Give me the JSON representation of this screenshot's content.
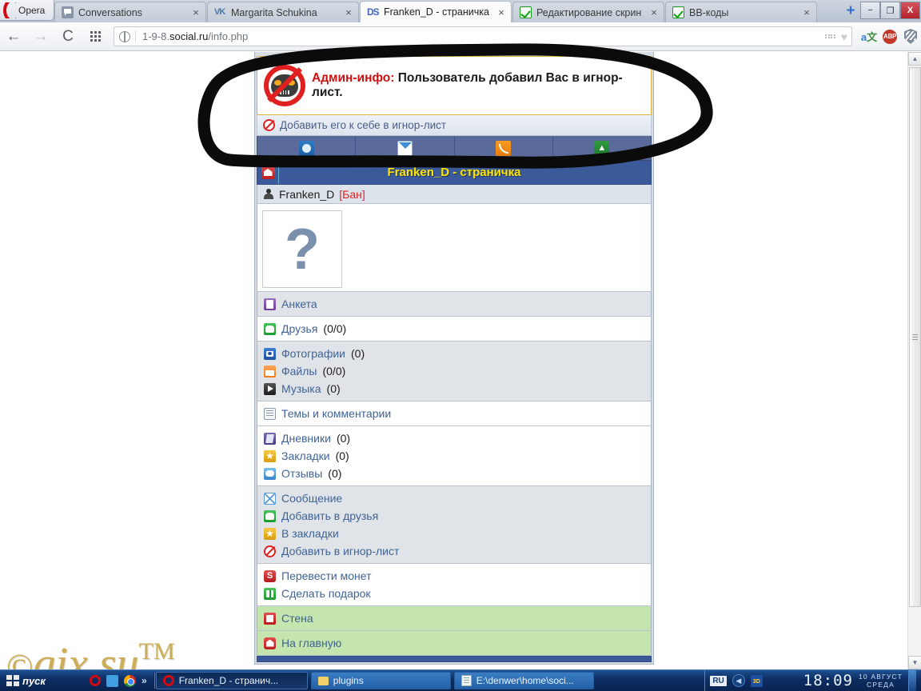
{
  "browser": {
    "app_button": "Opera",
    "tabs": [
      {
        "title": "Conversations",
        "favicon": "chat-icon",
        "active": false,
        "close": "×"
      },
      {
        "title": "Margarita Schukina",
        "favicon": "vk-icon",
        "active": false,
        "close": "×"
      },
      {
        "title": "Franken_D - страничка",
        "favicon": "ds-icon",
        "active": true,
        "close": "×"
      },
      {
        "title": "Редактирование скрин",
        "favicon": "checkbox-green-icon",
        "active": false,
        "close": "×"
      },
      {
        "title": "ВВ-коды",
        "favicon": "checkbox-green-icon",
        "active": false,
        "close": "×"
      }
    ],
    "new_tab": "+",
    "window_controls": {
      "minimize": "−",
      "maximize": "❐",
      "close": "X"
    },
    "url": {
      "prefix": "1-9-8.",
      "domain": "social.ru",
      "path": "/info.php"
    },
    "toolbar_icons": {
      "back": "←",
      "forward": "→",
      "reload": "C",
      "speeddial": "grid-icon",
      "translate": "translate-icon",
      "adblock": "ABP",
      "shield": "shield-icon"
    }
  },
  "page": {
    "notice": {
      "icon": "ban-robot-icon",
      "prefix": "Админ-инфо:",
      "message": "Пользователь добавил Вас в игнор-лист."
    },
    "ignore_bar": {
      "icon": "ban-icon",
      "label": "Добавить его к себе в игнор-лист"
    },
    "icon_row": [
      {
        "icon": "profile-blue-icon"
      },
      {
        "icon": "envelope-icon"
      },
      {
        "icon": "rss-icon"
      },
      {
        "icon": "green-arrow-icon"
      }
    ],
    "title_bar": {
      "home_icon": "home-icon",
      "title": "Franken_D - страничка"
    },
    "user_row": {
      "icon": "user-icon",
      "name": "Franken_D",
      "ban": "[Бан]"
    },
    "avatar": {
      "placeholder": "?"
    },
    "groups": [
      {
        "style": "gray",
        "items": [
          {
            "icon": "anketa-icon",
            "label": "Анкета",
            "count": ""
          }
        ]
      },
      {
        "style": "white",
        "items": [
          {
            "icon": "friends-icon",
            "label": "Друзья",
            "count": "(0/0)"
          }
        ]
      },
      {
        "style": "gray",
        "items": [
          {
            "icon": "photo-icon",
            "label": "Фотографии",
            "count": "(0)"
          },
          {
            "icon": "files-icon",
            "label": "Файлы",
            "count": "(0/0)"
          },
          {
            "icon": "music-icon",
            "label": "Музыка",
            "count": "(0)"
          }
        ]
      },
      {
        "style": "white",
        "items": [
          {
            "icon": "themes-icon",
            "label": "Темы и комментарии",
            "count": ""
          }
        ]
      },
      {
        "style": "white",
        "items": [
          {
            "icon": "diary-icon",
            "label": "Дневники",
            "count": "(0)"
          },
          {
            "icon": "star-icon",
            "label": "Закладки",
            "count": "(0)"
          },
          {
            "icon": "review-icon",
            "label": "Отзывы",
            "count": "(0)"
          }
        ]
      },
      {
        "style": "gray",
        "items": [
          {
            "icon": "message-icon",
            "label": "Сообщение",
            "count": ""
          },
          {
            "icon": "friends-icon",
            "label": "Добавить в друзья",
            "count": ""
          },
          {
            "icon": "star-icon",
            "label": "В закладки",
            "count": ""
          },
          {
            "icon": "ban-icon",
            "label": "Добавить в игнор-лист",
            "count": ""
          }
        ]
      },
      {
        "style": "white",
        "items": [
          {
            "icon": "coin-icon",
            "label": "Перевести монет",
            "count": ""
          },
          {
            "icon": "gift-icon",
            "label": "Сделать подарок",
            "count": ""
          }
        ]
      },
      {
        "style": "green",
        "items": [
          {
            "icon": "wall-icon",
            "label": "Стена",
            "count": ""
          }
        ]
      },
      {
        "style": "green",
        "items": [
          {
            "icon": "home-icon",
            "label": "На главную",
            "count": ""
          }
        ]
      }
    ]
  },
  "watermark": {
    "copy": "©",
    "text": "gix.su",
    "tm": "TM"
  },
  "taskbar": {
    "start": "пуск",
    "quick_launch": [
      "opera-icon",
      "ie-icon",
      "chrome-icon",
      "chevron-right-icon"
    ],
    "items": [
      {
        "icon": "opera-icon",
        "label": "Franken_D - странич...",
        "active": true
      },
      {
        "icon": "folder-icon",
        "label": "plugins",
        "active": false
      },
      {
        "icon": "notepad-icon",
        "label": "E:\\denwer\\home\\soci...",
        "active": false
      }
    ],
    "tray": {
      "language": "RU",
      "icons": [
        "xnview-icon",
        "ccleaner-icon",
        "keys-icon"
      ],
      "clock": "18:09",
      "date_line1": "10 АВГУСТ",
      "date_line2": "СРЕДА"
    }
  },
  "colors": {
    "accent_blue": "#3a5a9a",
    "title_yellow": "#ffe600",
    "alert_red": "#d01010",
    "link_blue": "#3f6394",
    "green_row": "#c4e5ae"
  }
}
